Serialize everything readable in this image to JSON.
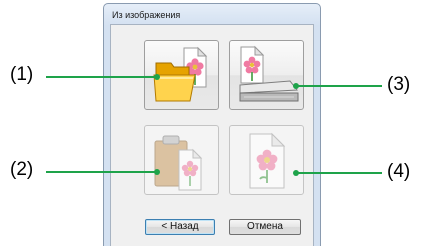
{
  "dialog": {
    "title": "Из изображения"
  },
  "options": [
    {
      "id": "open-file",
      "enabled": true,
      "icon": "folder-with-image-icon"
    },
    {
      "id": "scanner",
      "enabled": true,
      "icon": "scanner-with-image-icon"
    },
    {
      "id": "clipboard",
      "enabled": false,
      "icon": "clipboard-with-image-icon"
    },
    {
      "id": "blank-image",
      "enabled": false,
      "icon": "image-document-icon"
    }
  ],
  "buttons": {
    "back_label": "< Назад",
    "cancel_label": "Отмена"
  },
  "callouts": {
    "c1": "(1)",
    "c2": "(2)",
    "c3": "(3)",
    "c4": "(4)"
  },
  "colors": {
    "callout_line": "#1ea34a"
  }
}
